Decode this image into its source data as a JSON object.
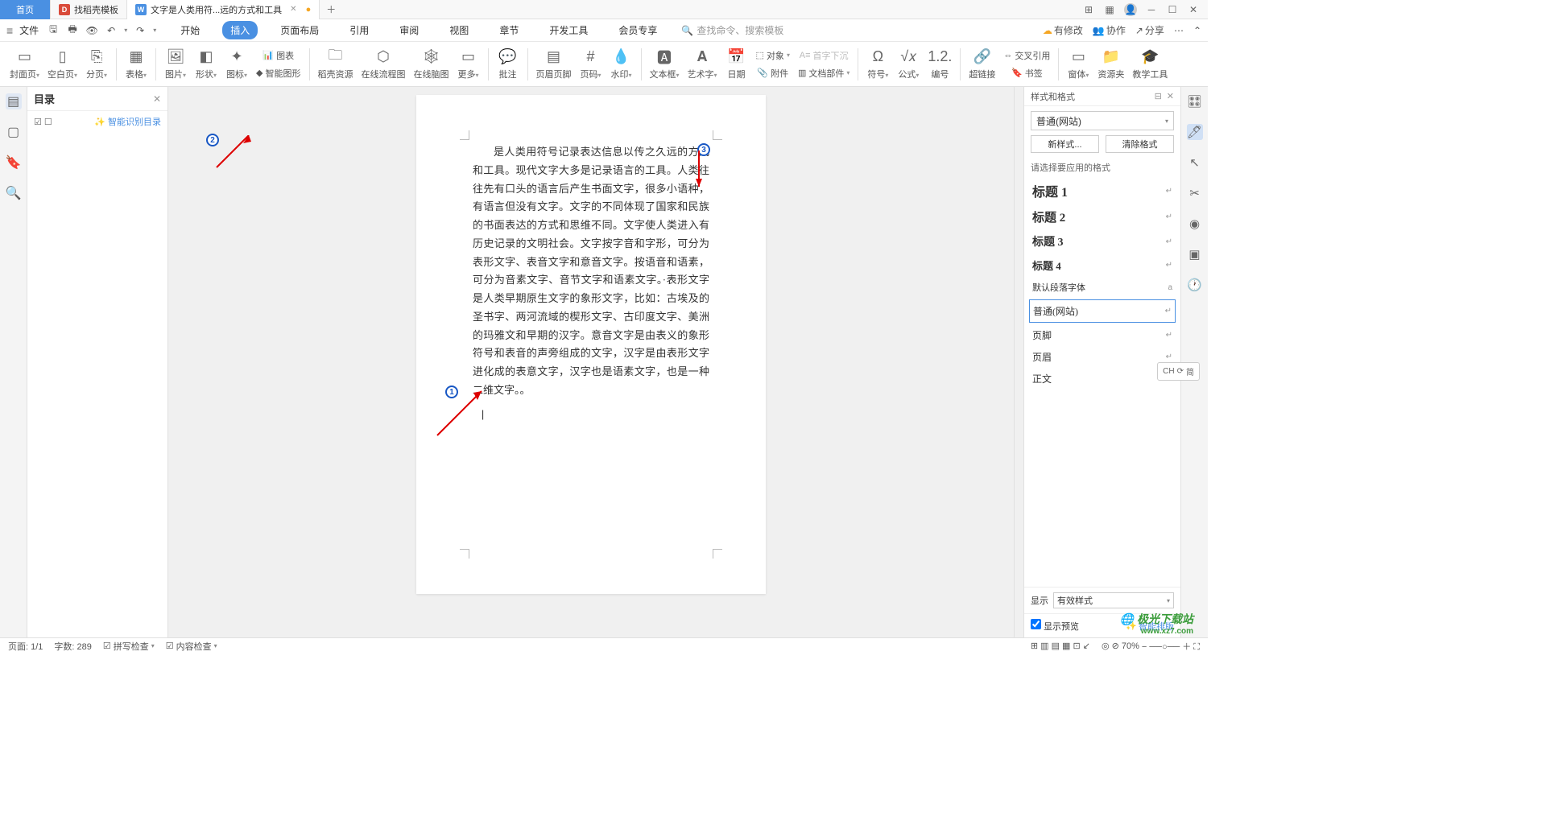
{
  "titlebar": {
    "tabs": [
      {
        "label": "首页",
        "type": "home"
      },
      {
        "label": "找稻壳模板",
        "icon_color": "#d94b3a"
      },
      {
        "label": "文字是人类用符...远的方式和工具",
        "icon_color": "#4a90e2"
      }
    ],
    "add": "＋"
  },
  "menubar": {
    "file": "文件",
    "main_tabs": [
      "开始",
      "插入",
      "页面布局",
      "引用",
      "审阅",
      "视图",
      "章节",
      "开发工具",
      "会员专享"
    ],
    "active_tab": "插入",
    "search_placeholder": "查找命令、搜索模板",
    "right": {
      "changes": "有修改",
      "collab": "协作",
      "share": "分享"
    }
  },
  "ribbon": {
    "items": [
      {
        "label": "封面页",
        "dd": true
      },
      {
        "label": "空白页",
        "dd": true
      },
      {
        "label": "分页",
        "dd": true
      },
      {
        "label": "表格",
        "dd": true
      },
      {
        "label": "图片",
        "dd": true
      },
      {
        "label": "形状",
        "dd": true
      },
      {
        "label": "图标",
        "dd": true
      },
      {
        "label": "智能图形"
      },
      {
        "label": "稻壳资源"
      },
      {
        "label": "在线流程图"
      },
      {
        "label": "在线脑图"
      },
      {
        "label": "更多",
        "dd": true
      },
      {
        "label": "批注"
      },
      {
        "label": "页眉页脚"
      },
      {
        "label": "页码",
        "dd": true
      },
      {
        "label": "水印",
        "dd": true
      },
      {
        "label": "文本框",
        "dd": true
      },
      {
        "label": "艺术字",
        "dd": true
      },
      {
        "label": "日期"
      },
      {
        "label": "附件"
      },
      {
        "label": "文档部件",
        "dd": true
      },
      {
        "label": "符号",
        "dd": true
      },
      {
        "label": "公式",
        "dd": true
      },
      {
        "label": "编号"
      },
      {
        "label": "超链接"
      },
      {
        "label": "书签"
      },
      {
        "label": "窗体",
        "dd": true
      },
      {
        "label": "资源夹"
      },
      {
        "label": "教学工具"
      }
    ],
    "side_items": {
      "chart": "图表",
      "object": "对象",
      "dropcap": "首字下沉",
      "crossref": "交叉引用"
    }
  },
  "toc": {
    "title": "目录",
    "smart": "智能识别目录"
  },
  "document": {
    "body": "是人类用符号记录表达信息以传之久远的方式和工具。现代文字大多是记录语言的工具。人类往往先有口头的语言后产生书面文字，很多小语种，有语言但没有文字。文字的不同体现了国家和民族的书面表达的方式和思维不同。文字使人类进入有历史记录的文明社会。文字按字音和字形，可分为表形文字、表音文字和意音文字。按语音和语素，可分为音素文字、音节文字和语素文字。·表形文字是人类早期原生文字的象形文字，比如：古埃及的圣书字、两河流域的楔形文字、古印度文字、美洲的玛雅文和早期的汉字。意音文字是由表义的象形符号和表音的声旁组成的文字，汉字是由表形文字进化成的表意文字，汉字也是语素文字，也是一种二维文字。。",
    "cursor": "|"
  },
  "styles_panel": {
    "title": "样式和格式",
    "current": "普通(网站)",
    "btn_new": "新样式...",
    "btn_clear": "清除格式",
    "apply_label": "请选择要应用的格式",
    "items": [
      {
        "name": "标题 1",
        "cls": "style-h1"
      },
      {
        "name": "标题 2",
        "cls": "style-h2"
      },
      {
        "name": "标题 3",
        "cls": "style-h3"
      },
      {
        "name": "标题 4",
        "cls": "style-h4"
      },
      {
        "name": "默认段落字体",
        "cls": "",
        "mark": "a"
      },
      {
        "name": "普通(网站)",
        "cls": "",
        "selected": true
      },
      {
        "name": "页脚",
        "cls": ""
      },
      {
        "name": "页眉",
        "cls": ""
      },
      {
        "name": "正文",
        "cls": ""
      }
    ],
    "show_label": "显示",
    "show_value": "有效样式",
    "preview_label": "显示预览",
    "smart_layout": "智能排版"
  },
  "ch_badge": {
    "text": "CH",
    "icon": "简"
  },
  "statusbar": {
    "page": "页面: 1/1",
    "words": "字数: 289",
    "spell": "拼写检查",
    "content": "内容检查",
    "zoom": "70%"
  },
  "annotations": {
    "b1": "1",
    "b2": "2",
    "b3": "3"
  },
  "watermark": {
    "logo": "极光下载站",
    "url": "www.xz7.com"
  }
}
